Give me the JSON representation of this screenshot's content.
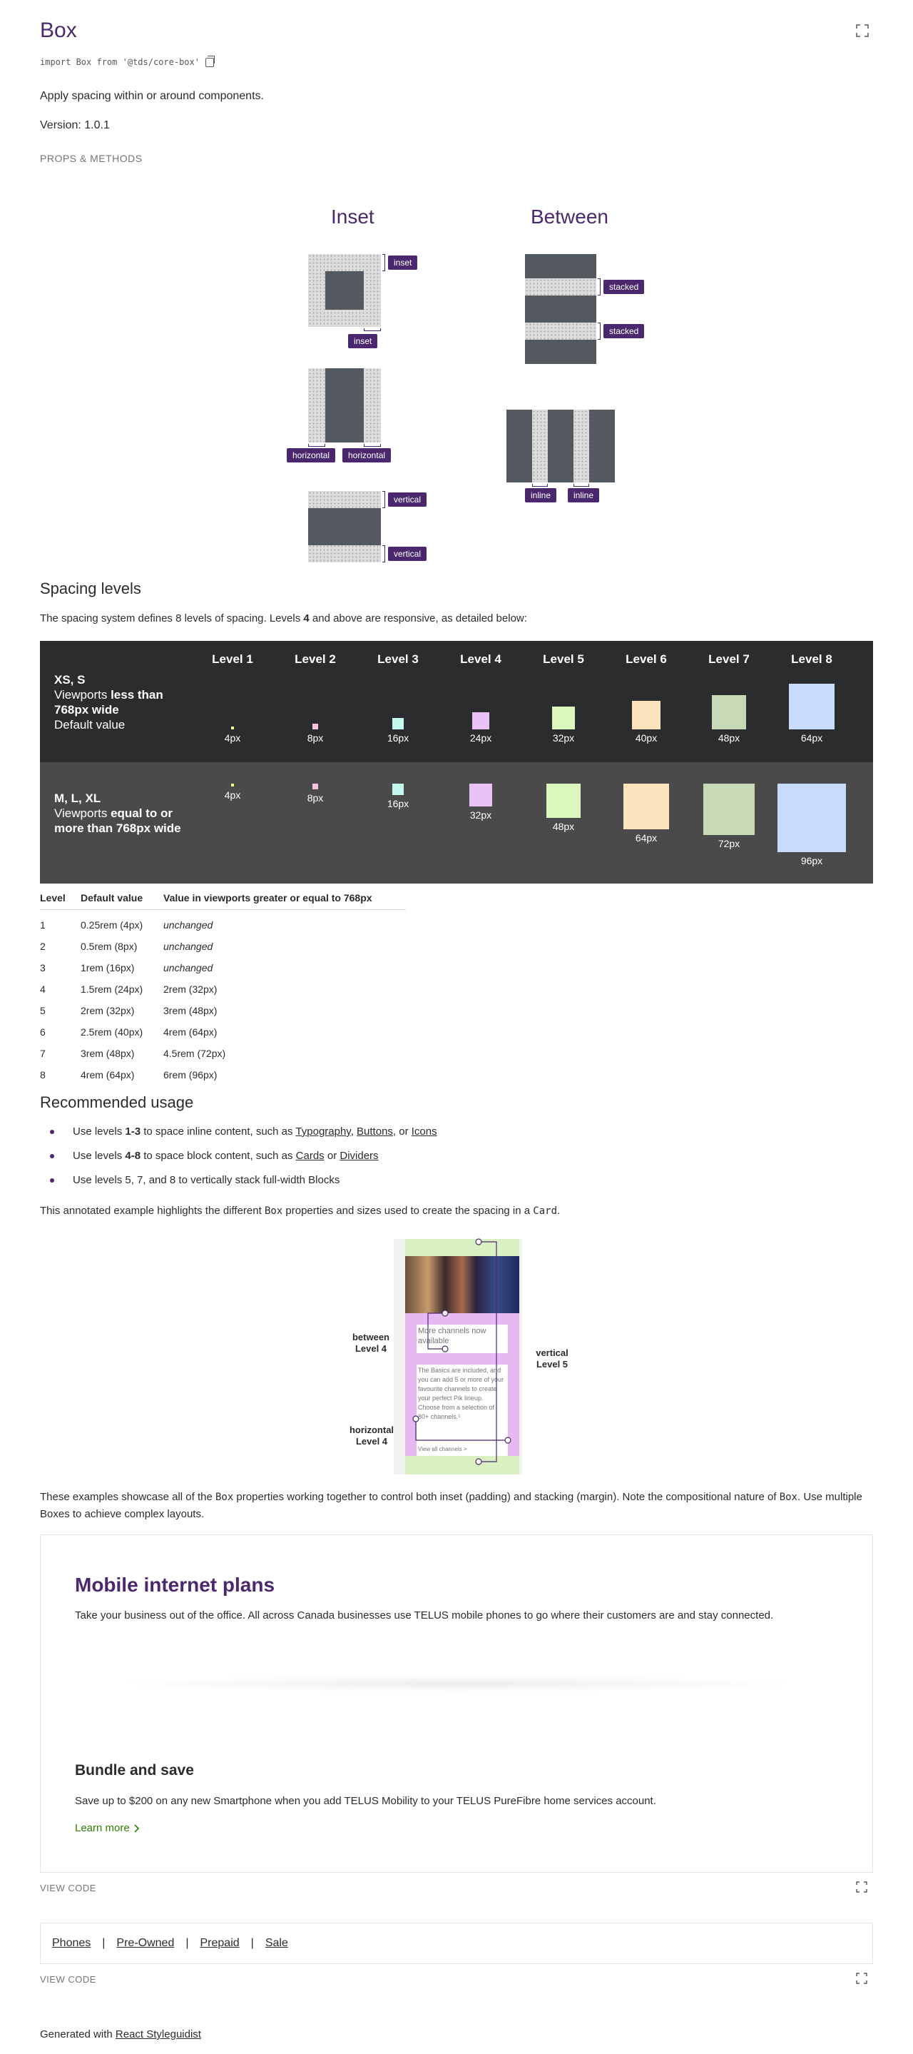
{
  "header": {
    "title": "Box",
    "import_statement": "import Box from '@tds/core-box'",
    "description": "Apply spacing within or around components.",
    "version": "Version: 1.0.1",
    "props_link": "PROPS & METHODS"
  },
  "illustration": {
    "inset_heading": "Inset",
    "between_heading": "Between",
    "tags": {
      "inset": "inset",
      "stacked": "stacked",
      "horizontal": "horizontal",
      "vertical": "vertical",
      "inline": "inline"
    }
  },
  "spacing_levels": {
    "heading": "Spacing levels",
    "intro_pre": "The spacing system defines 8 levels of spacing. Levels ",
    "intro_bold": "4",
    "intro_post": " and above are responsive, as detailed below:",
    "level_headers": [
      "Level 1",
      "Level 2",
      "Level 3",
      "Level 4",
      "Level 5",
      "Level 6",
      "Level 7",
      "Level 8"
    ],
    "small_viewport": {
      "title": "XS, S",
      "line1_pre": "Viewports ",
      "line1_bold": "less than 768px wide",
      "line2": "Default value",
      "sizes": [
        "4px",
        "8px",
        "16px",
        "24px",
        "32px",
        "40px",
        "48px",
        "64px"
      ]
    },
    "large_viewport": {
      "title": "M, L, XL",
      "line1_pre": "Viewports ",
      "line1_bold": "equal to or more than 768px wide",
      "sizes": [
        "4px",
        "8px",
        "16px",
        "32px",
        "48px",
        "64px",
        "72px",
        "96px"
      ]
    },
    "swatch_colors": [
      "#f7fd8c",
      "#f9c4e0",
      "#c6f7ef",
      "#e9c2f8",
      "#dcf7bd",
      "#fbe3bd",
      "#c8d9b8",
      "#c9dbfa"
    ]
  },
  "table": {
    "headers": [
      "Level",
      "Default value",
      "Value in viewports greater or equal to 768px"
    ],
    "rows": [
      [
        "1",
        "0.25rem (4px)",
        "unchanged"
      ],
      [
        "2",
        "0.5rem (8px)",
        "unchanged"
      ],
      [
        "3",
        "1rem (16px)",
        "unchanged"
      ],
      [
        "4",
        "1.5rem (24px)",
        "2rem (32px)"
      ],
      [
        "5",
        "2rem (32px)",
        "3rem (48px)"
      ],
      [
        "6",
        "2.5rem (40px)",
        "4rem (64px)"
      ],
      [
        "7",
        "3rem (48px)",
        "4.5rem (72px)"
      ],
      [
        "8",
        "4rem (64px)",
        "6rem (96px)"
      ]
    ]
  },
  "recommended": {
    "heading": "Recommended usage",
    "items": [
      {
        "pre": "Use levels ",
        "bold": "1-3",
        "mid": " to space inline content, such as ",
        "links": [
          "Typography",
          "Buttons",
          "Icons"
        ]
      },
      {
        "pre": "Use levels ",
        "bold": "4-8",
        "mid": " to space block content, such as ",
        "links": [
          "Cards",
          "Dividers"
        ]
      },
      {
        "text": "Use levels 5, 7, and 8 to vertically stack full-width Blocks"
      }
    ],
    "annotation_text_pre": "This annotated example highlights the different ",
    "annotation_code1": "Box",
    "annotation_text_mid": " properties and sizes used to create the spacing in a ",
    "annotation_code2": "Card",
    "annotation_text_post": "."
  },
  "annotated_card": {
    "between_label": "between Level 4",
    "horizontal_label": "horizontal Level 4",
    "vertical_label": "vertical Level 5",
    "card_heading": "More channels now available",
    "card_body": "The Basics are included, and you can add 5 or more of your favourite channels to create your perfect Pik lineup. Choose from a selection of 80+ channels.¹",
    "card_link": "View all channels >"
  },
  "showcase": {
    "text_pre": "These examples showcase all of the ",
    "code1": "Box",
    "text_mid": " properties working together to control both inset (padding) and stacking (margin). Note the compositional nature of ",
    "code2": "Box",
    "text_post": ". Use multiple Boxes to achieve complex layouts."
  },
  "example1": {
    "title": "Mobile internet plans",
    "subtitle": "Take your business out of the office. All across Canada businesses use TELUS mobile phones to go where their customers are and stay connected.",
    "bundle_heading": "Bundle and save",
    "bundle_text": "Save up to $200 on any new Smartphone when you add TELUS Mobility to your TELUS PureFibre home services account.",
    "link_label": "Learn more",
    "view_code": "VIEW CODE"
  },
  "example2": {
    "links": [
      "Phones",
      "Pre-Owned",
      "Prepaid",
      "Sale"
    ],
    "separator": "|",
    "view_code": "VIEW CODE"
  },
  "footer": {
    "pre": "Generated with ",
    "link": "React Styleguidist"
  }
}
